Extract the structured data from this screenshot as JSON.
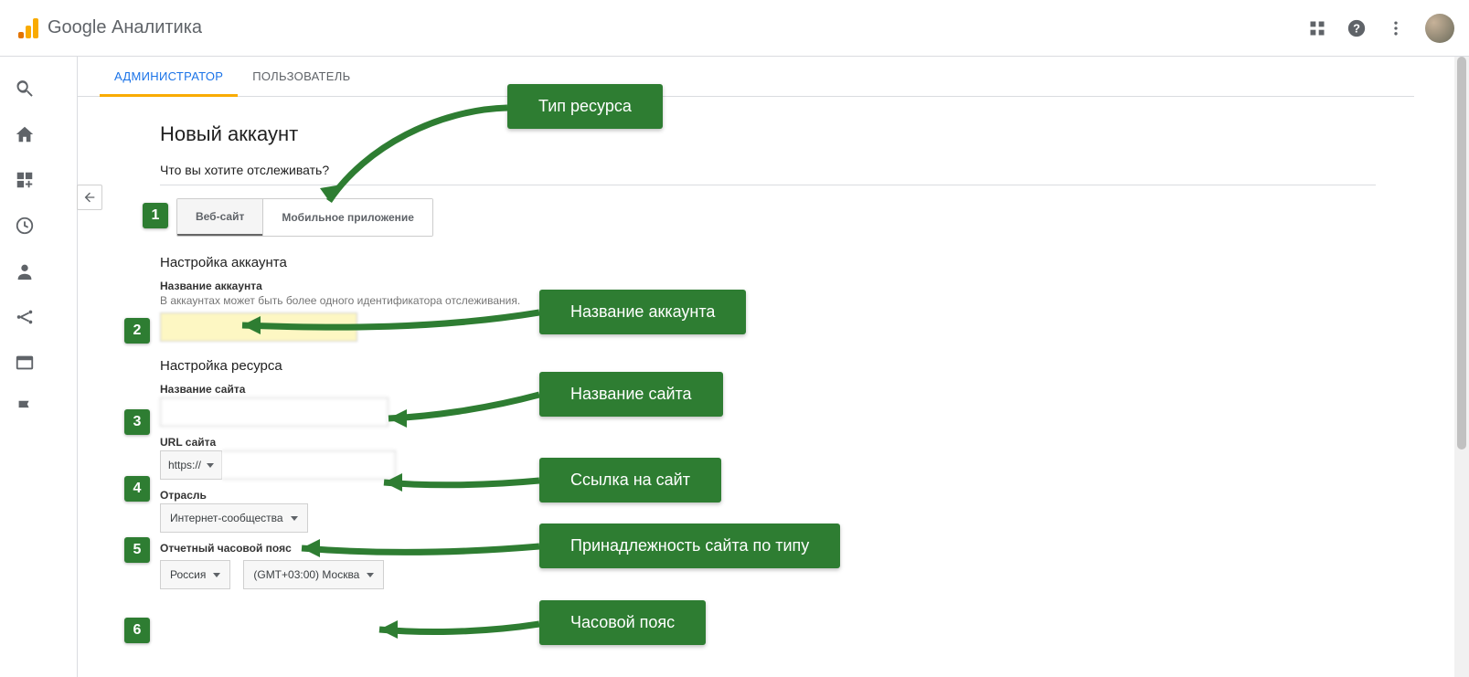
{
  "brand": "Google Аналитика",
  "tabs": {
    "admin": "АДМИНИСТРАТОР",
    "user": "ПОЛЬЗОВАТЕЛЬ"
  },
  "page_title": "Новый аккаунт",
  "track_question": "Что вы хотите отслеживать?",
  "toggle": {
    "web": "Веб-сайт",
    "app": "Мобильное приложение"
  },
  "account_setup": {
    "title": "Настройка аккаунта",
    "name_label": "Название аккаунта",
    "name_hint": "В аккаунтах может быть более одного идентификатора отслеживания."
  },
  "resource_setup": {
    "title": "Настройка ресурса",
    "site_name_label": "Название сайта",
    "url_label": "URL сайта",
    "protocol": "https://",
    "industry_label": "Отрасль",
    "industry_value": "Интернет-сообщества",
    "tz_label": "Отчетный часовой пояс",
    "country": "Россия",
    "tz_value": "(GMT+03:00) Москва"
  },
  "callouts": {
    "c1": "Тип ресурса",
    "c2": "Название аккаунта",
    "c3": "Название сайта",
    "c4": "Ссылка на сайт",
    "c5": "Принадлежность сайта по типу",
    "c6": "Часовой пояс"
  },
  "badges": {
    "b1": "1",
    "b2": "2",
    "b3": "3",
    "b4": "4",
    "b5": "5",
    "b6": "6"
  }
}
